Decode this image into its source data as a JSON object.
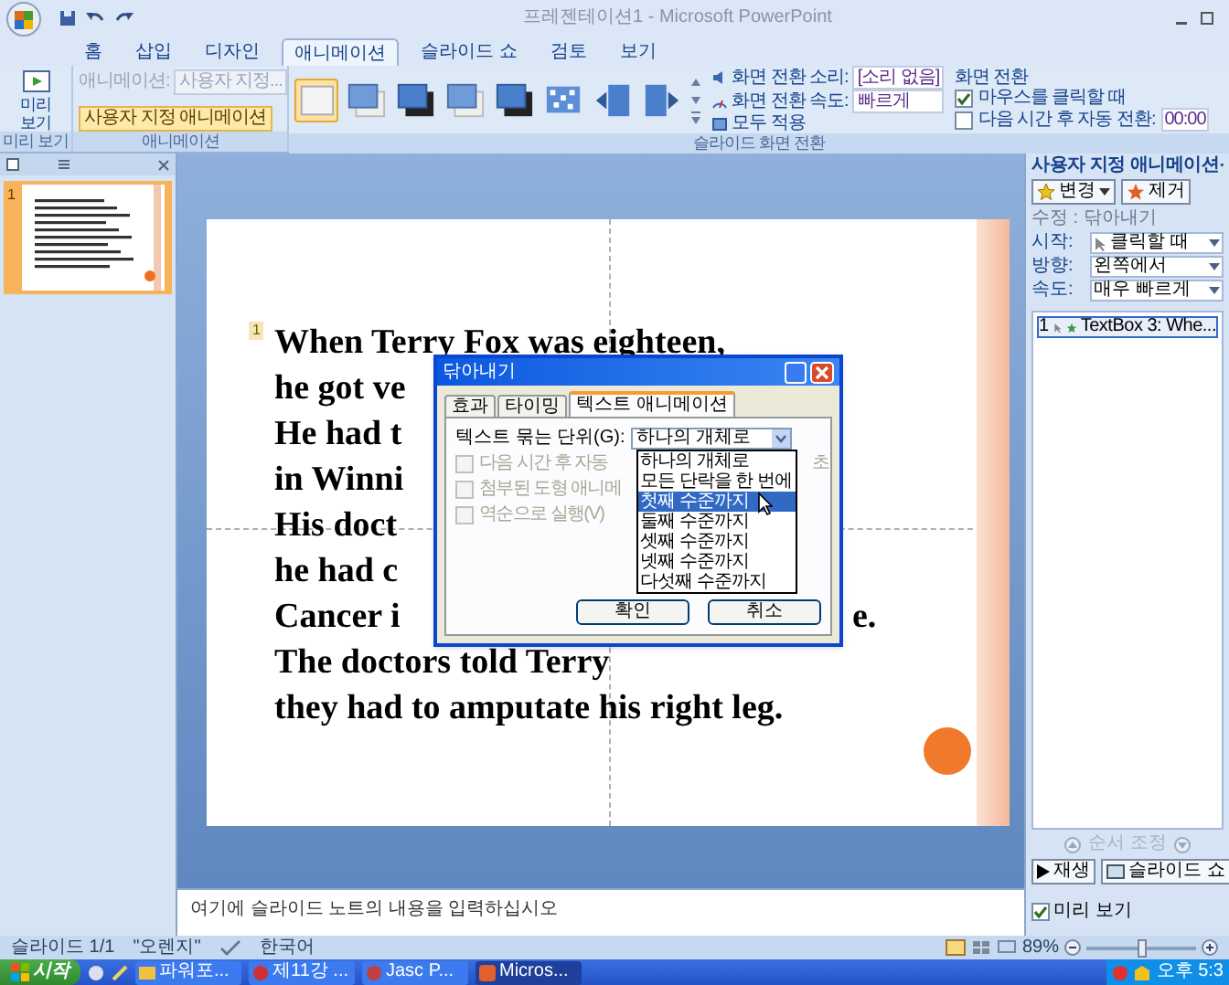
{
  "window": {
    "title": "프레젠테이션1 - Microsoft PowerPoint"
  },
  "ribbon_tabs": [
    {
      "label": "홈",
      "selected": false
    },
    {
      "label": "삽입",
      "selected": false
    },
    {
      "label": "디자인",
      "selected": false
    },
    {
      "label": "애니메이션",
      "selected": true
    },
    {
      "label": "슬라이드 쇼",
      "selected": false
    },
    {
      "label": "검토",
      "selected": false
    },
    {
      "label": "보기",
      "selected": false
    }
  ],
  "ribbon": {
    "preview": {
      "button": "미리 보기",
      "group_label": "미리 보기"
    },
    "animation": {
      "animate_label": "애니메이션:",
      "animate_value": "사용자 지정...",
      "custom_button": "사용자 지정 애니메이션",
      "group_label": "애니메이션"
    },
    "transition": {
      "thumbnails": [
        {
          "kind": "none",
          "selected": true
        },
        {
          "kind": "fade",
          "selected": false
        },
        {
          "kind": "dark",
          "selected": false
        },
        {
          "kind": "fade",
          "selected": false
        },
        {
          "kind": "dark",
          "selected": false
        },
        {
          "kind": "dissolve",
          "selected": false
        },
        {
          "kind": "push-left",
          "selected": false
        },
        {
          "kind": "push-right",
          "selected": false
        }
      ],
      "sound_label": "화면 전환 소리:",
      "sound_value": "[소리 없음]",
      "speed_label": "화면 전환 속도:",
      "speed_value": "빠르게",
      "apply_all": "모두 적용",
      "advance_title": "화면 전환",
      "on_click": {
        "label": "마우스를 클릭할 때",
        "checked": true
      },
      "auto": {
        "label": "다음 시간 후 자동 전환:",
        "checked": false,
        "value": "00:00"
      },
      "group_label": "슬라이드 화면 전환"
    }
  },
  "slides_panel": {
    "slides": [
      {
        "number": "1",
        "selected": true
      }
    ]
  },
  "slide": {
    "animation_tag": "1",
    "lines": [
      {
        "text": "When Terry Fox was eighteen,"
      },
      {
        "text": "he got ve"
      },
      {
        "text": "He had t"
      },
      {
        "text": "in Winni"
      },
      {
        "text": "His doct"
      },
      {
        "text": "he had c"
      },
      {
        "text": "Cancer i",
        "tail": "e."
      },
      {
        "text": "The doctors told Terry"
      },
      {
        "text": "they had to amputate his right leg."
      }
    ]
  },
  "dialog": {
    "title": "닦아내기",
    "tabs": [
      {
        "label": "효과",
        "selected": false
      },
      {
        "label": "타이밍",
        "selected": false
      },
      {
        "label": "텍스트 애니메이션",
        "selected": true
      }
    ],
    "group_text_label": "텍스트 묶는 단위(G):",
    "group_text_value": "하나의 개체로",
    "options": [
      {
        "label": "다음 시간 후 자동",
        "checked": false,
        "disabled": true
      },
      {
        "label": "첨부된 도형 애니메",
        "checked": false,
        "disabled": true
      },
      {
        "label": "역순으로 실행(V)",
        "checked": false,
        "disabled": true
      }
    ],
    "seconds_label": "초",
    "dropdown_items": [
      {
        "label": "하나의 개체로",
        "selected": false
      },
      {
        "label": "모든 단락을 한 번에",
        "selected": false
      },
      {
        "label": "첫째 수준까지",
        "selected": true
      },
      {
        "label": "둘째 수준까지",
        "selected": false
      },
      {
        "label": "셋째 수준까지",
        "selected": false
      },
      {
        "label": "넷째 수준까지",
        "selected": false
      },
      {
        "label": "다섯째 수준까지",
        "selected": false
      }
    ],
    "buttons": [
      "확인",
      "취소"
    ]
  },
  "task_pane": {
    "title": "사용자 지정 애니메이션",
    "change_button": "변경",
    "remove_button": "제거",
    "modify_label": "수정 : 닦아내기",
    "fields": [
      {
        "label": "시작:",
        "value": "클릭할 때",
        "kind": "mouse"
      },
      {
        "label": "방향:",
        "value": "왼쪽에서",
        "kind": "plain"
      },
      {
        "label": "속도:",
        "value": "매우 빠르게",
        "kind": "plain"
      }
    ],
    "effects": [
      {
        "number": "1",
        "label": "TextBox 3: Whe...",
        "selected": true
      }
    ],
    "reorder_label": "순서 조정",
    "play_button": "재생",
    "slideshow_button": "슬라이드 쇼",
    "autopreview": {
      "label": "미리 보기",
      "checked": true
    }
  },
  "notes": {
    "placeholder": "여기에 슬라이드 노트의 내용을 입력하십시오"
  },
  "status_bar": {
    "slide": "슬라이드 1/1",
    "theme": "\"오렌지\"",
    "language": "한국어",
    "zoom": "89%",
    "zoom_slider": {
      "level": 0.5
    }
  },
  "taskbar": {
    "start": "시작",
    "tasks": [
      {
        "label": "파워포...",
        "selected": false
      },
      {
        "label": "제11강 ...",
        "selected": false
      },
      {
        "label": "Jasc P...",
        "selected": false
      },
      {
        "label": "Micros...",
        "selected": true
      }
    ],
    "clock": "오후 5:3"
  }
}
